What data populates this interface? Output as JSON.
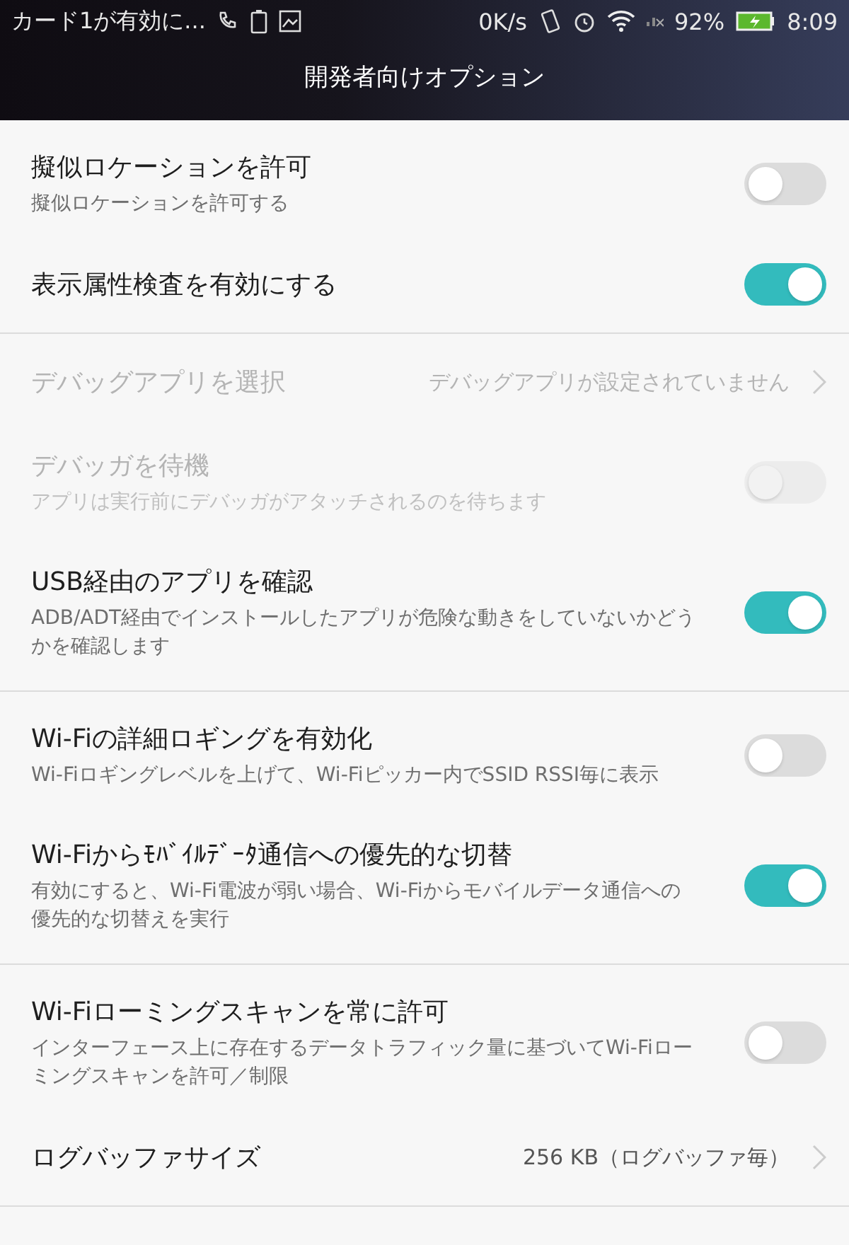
{
  "status_bar": {
    "notification": "カード1が有効に...",
    "speed": "0K/s",
    "battery": "92%",
    "time": "8:09"
  },
  "title": "開発者向けオプション",
  "sections": [
    {
      "items": [
        {
          "kind": "toggle",
          "title": "擬似ロケーションを許可",
          "subtitle": "擬似ロケーションを許可する",
          "on": false,
          "disabled": false
        },
        {
          "kind": "toggle",
          "title": "表示属性検査を有効にする",
          "on": true,
          "disabled": false
        }
      ]
    },
    {
      "items": [
        {
          "kind": "value",
          "title": "デバッグアプリを選択",
          "value": "デバッグアプリが設定されていません",
          "disabled": true
        },
        {
          "kind": "toggle",
          "title": "デバッガを待機",
          "subtitle": "アプリは実行前にデバッガがアタッチされるのを待ちます",
          "on": false,
          "disabled": true
        },
        {
          "kind": "toggle",
          "title": "USB経由のアプリを確認",
          "subtitle": "ADB/ADT経由でインストールしたアプリが危険な動きをしていないかどうかを確認します",
          "on": true,
          "disabled": false
        }
      ]
    },
    {
      "items": [
        {
          "kind": "toggle",
          "title": "Wi-Fiの詳細ロギングを有効化",
          "subtitle": "Wi-Fiロギングレベルを上げて、Wi-Fiピッカー内でSSID RSSI毎に表示",
          "on": false,
          "disabled": false
        },
        {
          "kind": "toggle",
          "title": "Wi-Fiからﾓﾊﾞｲﾙﾃﾞｰﾀ通信への優先的な切替",
          "subtitle": "有効にすると、Wi-Fi電波が弱い場合、Wi-Fiからモバイルデータ通信への優先的な切替えを実行",
          "on": true,
          "disabled": false
        }
      ]
    },
    {
      "items": [
        {
          "kind": "toggle",
          "title": "Wi-Fiローミングスキャンを常に許可",
          "subtitle": "インターフェース上に存在するデータトラフィック量に基づいてWi-Fiローミングスキャンを許可／制限",
          "on": false,
          "disabled": false
        },
        {
          "kind": "value",
          "title": "ログバッファサイズ",
          "value": "256 KB（ログバッファ毎）",
          "disabled": false
        }
      ]
    }
  ]
}
